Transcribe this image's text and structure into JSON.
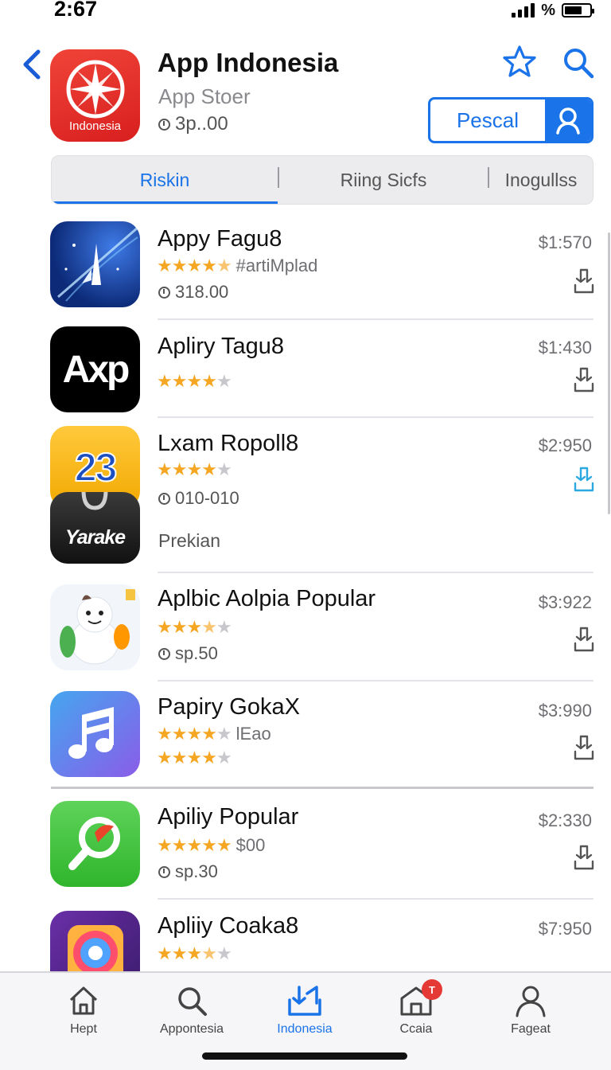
{
  "status": {
    "time": "2:67",
    "pct": "%",
    "battery_level": 0.7
  },
  "header": {
    "hero_icon_text": "Indonesia",
    "title": "App Indonesia",
    "subtitle": "App Stoer",
    "price": "3p..00",
    "action_label": "Pescal"
  },
  "tabs": [
    {
      "label": "Riskin",
      "active": true
    },
    {
      "label": "Riing Sicfs",
      "active": false
    },
    {
      "label": "Inogullss",
      "active": false
    }
  ],
  "apps": [
    {
      "name": "Appy Fagu8",
      "price": "$1:570",
      "rating": 4.5,
      "rating_text": "#artiMplad",
      "meta": "318.00",
      "icon": "rocket-icon",
      "icon_text": ""
    },
    {
      "name": "Apliry Tagu8",
      "price": "$1:430",
      "rating": 4,
      "rating_text": "",
      "meta": "",
      "icon": "axp-icon",
      "icon_text": "Axp"
    },
    {
      "name": "Lxam Ropoll8",
      "price": "$2:950",
      "rating": 4,
      "rating_text": "",
      "meta": "010-010",
      "icon": "calendar-icon",
      "icon_text": "23"
    },
    {
      "name": "",
      "price": "",
      "rating": 0,
      "rating_text": "",
      "meta": "Prekian",
      "icon": "bag-icon",
      "icon_text": "Yarake"
    },
    {
      "name": "Aplbic Aolpia Popular",
      "price": "$3:922",
      "rating": 3.5,
      "rating_text": "",
      "meta": "sp.50",
      "icon": "snowman-icon",
      "icon_text": ""
    },
    {
      "name": "Papiry GokaX",
      "price": "$3:990",
      "rating": 4,
      "rating_text": "lEao",
      "meta": "",
      "icon": "music-icon",
      "icon_text": ""
    },
    {
      "name": "Apiliy Popular",
      "price": "$2:330",
      "rating": 5,
      "rating_text": "$00",
      "meta": "sp.30",
      "icon": "search-app-icon",
      "icon_text": ""
    },
    {
      "name": "Apliiy Coaka8",
      "price": "$7:950",
      "rating": 3.5,
      "rating_text": "",
      "meta": "",
      "icon": "camera-icon",
      "icon_text": ""
    }
  ],
  "colors": {
    "accent": "#1a73e8",
    "star": "#f5a623",
    "badge": "#e53935"
  },
  "tabbar": [
    {
      "label": "Hept",
      "icon": "home-icon",
      "active": false
    },
    {
      "label": "Appontesia",
      "icon": "search-icon",
      "active": false
    },
    {
      "label": "Indonesia",
      "icon": "download-icon",
      "active": true
    },
    {
      "label": "Ccaia",
      "icon": "store-icon",
      "active": false,
      "badge": "T"
    },
    {
      "label": "Fageat",
      "icon": "profile-icon",
      "active": false
    }
  ]
}
